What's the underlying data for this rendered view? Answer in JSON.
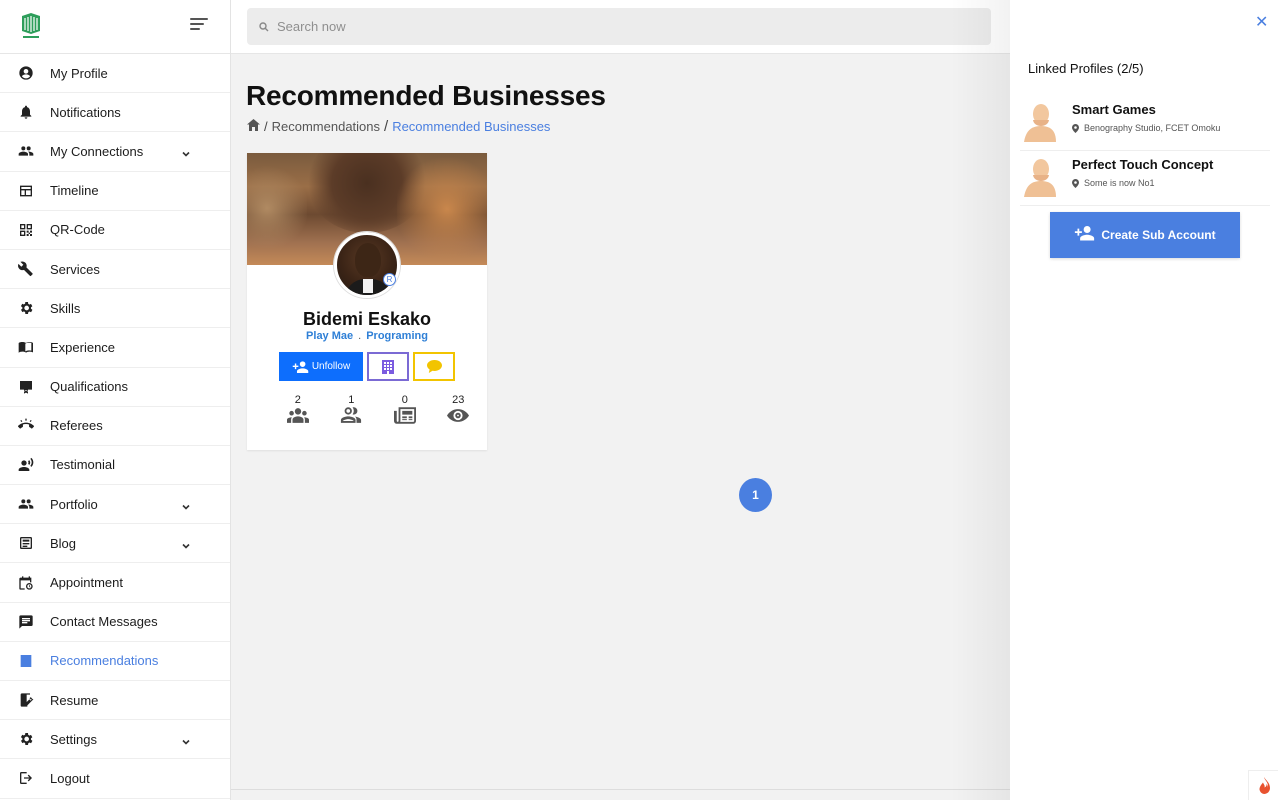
{
  "search": {
    "placeholder": "Search now",
    "icon": "search-icon"
  },
  "sidebar": {
    "items": [
      {
        "label": "My Profile",
        "icon": "account-circle-icon",
        "has_submenu": false,
        "active": false
      },
      {
        "label": "Notifications",
        "icon": "bell-icon",
        "has_submenu": false,
        "active": false
      },
      {
        "label": "My Connections",
        "icon": "people-icon",
        "has_submenu": true,
        "active": false
      },
      {
        "label": "Timeline",
        "icon": "timeline-icon",
        "has_submenu": false,
        "active": false
      },
      {
        "label": "QR-Code",
        "icon": "qr-code-icon",
        "has_submenu": false,
        "active": false
      },
      {
        "label": "Services",
        "icon": "tools-icon",
        "has_submenu": false,
        "active": false
      },
      {
        "label": "Skills",
        "icon": "cog-badge-icon",
        "has_submenu": false,
        "active": false
      },
      {
        "label": "Experience",
        "icon": "book-icon",
        "has_submenu": false,
        "active": false
      },
      {
        "label": "Qualifications",
        "icon": "certificate-icon",
        "has_submenu": false,
        "active": false
      },
      {
        "label": "Referees",
        "icon": "phone-ring-icon",
        "has_submenu": false,
        "active": false
      },
      {
        "label": "Testimonial",
        "icon": "speaking-person-icon",
        "has_submenu": false,
        "active": false
      },
      {
        "label": "Portfolio",
        "icon": "people-icon",
        "has_submenu": true,
        "active": false
      },
      {
        "label": "Blog",
        "icon": "article-icon",
        "has_submenu": true,
        "active": false
      },
      {
        "label": "Appointment",
        "icon": "calendar-clock-icon",
        "has_submenu": false,
        "active": false
      },
      {
        "label": "Contact Messages",
        "icon": "message-icon",
        "has_submenu": false,
        "active": false
      },
      {
        "label": "Recommendations",
        "icon": "recommend-icon",
        "has_submenu": false,
        "active": true
      },
      {
        "label": "Resume",
        "icon": "edit-document-icon",
        "has_submenu": false,
        "active": false
      },
      {
        "label": "Settings",
        "icon": "gear-icon",
        "has_submenu": true,
        "active": false
      },
      {
        "label": "Logout",
        "icon": "logout-icon",
        "has_submenu": false,
        "active": false
      }
    ]
  },
  "main": {
    "title": "Recommended Businesses",
    "breadcrumb": {
      "parent": "Recommendations",
      "current": "Recommended Businesses",
      "separator": "/"
    },
    "card": {
      "name": "Bidemi Eskako",
      "tags": [
        "Play Mae",
        "Programing"
      ],
      "tag_separator": ".",
      "badge": "R",
      "unfollow_label": "Unfollow",
      "stats": [
        {
          "value": "2",
          "icon": "group-icon"
        },
        {
          "value": "1",
          "icon": "people-outline-icon"
        },
        {
          "value": "0",
          "icon": "newspaper-icon"
        },
        {
          "value": "23",
          "icon": "eye-icon"
        }
      ]
    },
    "pagination": {
      "current": "1"
    }
  },
  "panel": {
    "title": "Linked Profiles (2/5)",
    "profiles": [
      {
        "name": "Smart Games",
        "location": "Benography Studio, FCET Omoku"
      },
      {
        "name": "Perfect Touch Concept",
        "location": "Some is now No1"
      }
    ],
    "create_label": "Create Sub Account",
    "close_glyph": "✕"
  },
  "colors": {
    "accent": "#4a7fe0",
    "primary_button": "#0d6efd",
    "business_border": "#7b6ad4",
    "message_border": "#f2c400"
  }
}
